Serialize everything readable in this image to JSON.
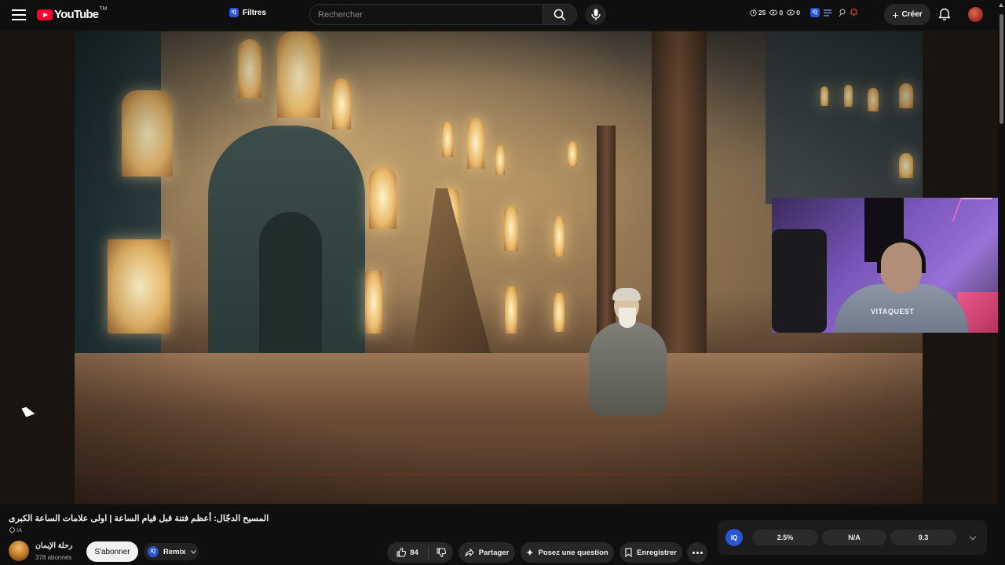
{
  "header": {
    "logo_text": "YouTube",
    "logo_sup": "TM",
    "filters_label": "Filtres",
    "search_placeholder": "Rechercher",
    "stats": [
      {
        "icon": "clock-icon",
        "value": "25"
      },
      {
        "icon": "eye-icon",
        "value": "0"
      },
      {
        "icon": "eye-icon",
        "value": "0"
      }
    ],
    "create_label": "Créer"
  },
  "video": {
    "title": "المسيح الدجّال: أعظم فتنة قبل قيام الساعة | اولى علامات الساعة الكبرى",
    "ai_tag": "IA",
    "webcam_shirt_text": "VITAQUEST"
  },
  "channel": {
    "name": "رحلة الإيمان",
    "subscribers": "378 abonnés",
    "subscribe_label": "S'abonner",
    "remix_label": "Remix"
  },
  "actions": {
    "like_count": "84",
    "share_label": "Partager",
    "ask_label": "Posez une question",
    "save_label": "Enregistrer"
  },
  "iq_panel": {
    "logo": "IQ",
    "metric_1": "2.5%",
    "metric_2": "N/A",
    "metric_3": "9.3"
  },
  "colors": {
    "background": "#0f0f0f",
    "brand_red": "#ff0033",
    "iq_blue": "#2a55d6",
    "button_bg": "#272727",
    "subscribe_bg": "#f1f1f1"
  }
}
